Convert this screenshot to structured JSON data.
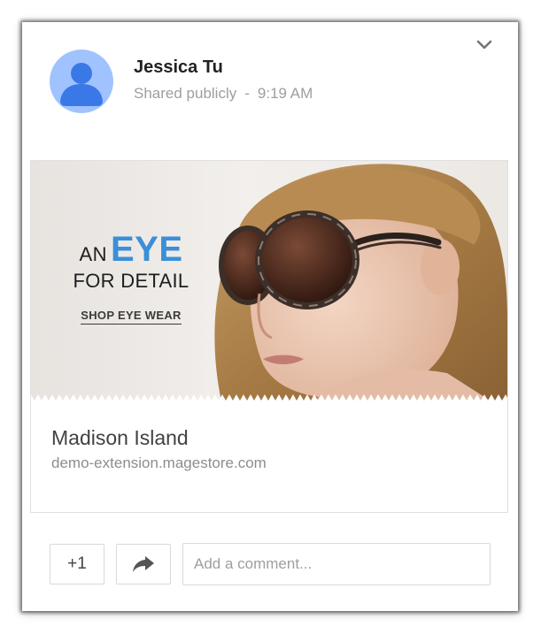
{
  "post": {
    "author_name": "Jessica Tu",
    "visibility": "Shared publicly",
    "separator": "-",
    "time": "9:19 AM"
  },
  "link_preview": {
    "banner": {
      "line1_prefix": "AN",
      "line1_highlight": "EYE",
      "line2": "FOR DETAIL",
      "cta": "SHOP EYE WEAR"
    },
    "title": "Madison Island",
    "domain": "demo-extension.magestore.com"
  },
  "actions": {
    "plus_one_label": "+1",
    "comment_placeholder": "Add a comment..."
  },
  "icons": {
    "menu": "chevron-down-icon",
    "share": "share-arrow-icon",
    "avatar": "default-person-avatar"
  },
  "colors": {
    "accent_blue": "#3a8fd8",
    "avatar_bg": "#a0c3ff",
    "avatar_fg": "#3b78e7"
  }
}
